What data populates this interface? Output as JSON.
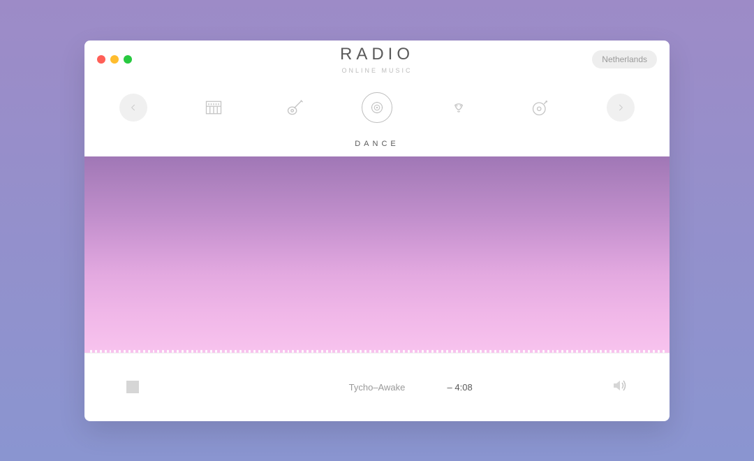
{
  "brand": {
    "title": "RADIO",
    "subtitle": "ONLINE MUSIC"
  },
  "location": "Netherlands",
  "genres": {
    "active_label": "DANCE",
    "items": [
      {
        "id": "piano",
        "icon": "piano"
      },
      {
        "id": "guitar",
        "icon": "guitar"
      },
      {
        "id": "dance",
        "icon": "speaker",
        "active": true
      },
      {
        "id": "jazz",
        "icon": "trumpet"
      },
      {
        "id": "vinyl",
        "icon": "vinyl"
      }
    ]
  },
  "player": {
    "track": "Tycho–Awake",
    "time": "– 4:08"
  }
}
